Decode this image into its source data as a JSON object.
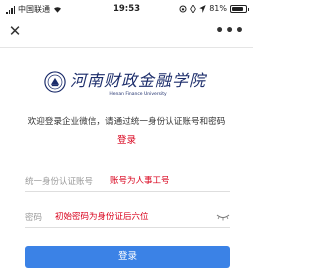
{
  "status_bar": {
    "carrier": "中国联通",
    "time": "19:53",
    "battery": "81%",
    "battery_level": 0.81
  },
  "nav": {
    "close_icon": "close-icon",
    "more_icon": "more-icon"
  },
  "logo": {
    "name_cn": "河南财政金融学院",
    "name_en": "Henan Finance University",
    "brand_color": "#1c2d6b"
  },
  "welcome_text": "欢迎登录企业微信，请通过统一身份认证账号和密码",
  "login_title": "登录",
  "form": {
    "account_label": "统一身份认证账号",
    "account_placeholder": "账号为人事工号",
    "password_label": "密码",
    "password_placeholder": "初始密码为身份证后六位"
  },
  "login_button": "登录",
  "colors": {
    "accent_red": "#d9001b",
    "button_blue": "#3b82e6"
  }
}
